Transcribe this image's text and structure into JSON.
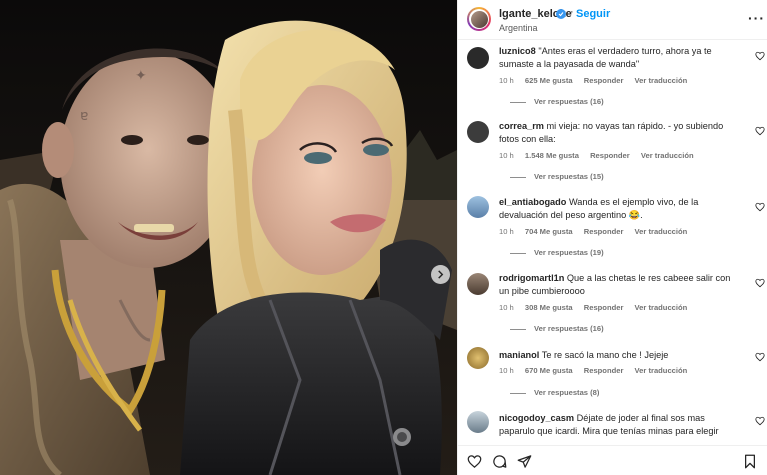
{
  "post": {
    "username": "lgante_keloke",
    "follow_label": "Seguir",
    "location": "Argentina",
    "more_label": "···"
  },
  "comments": [
    {
      "username": "luznico8",
      "text": "\"Antes eras el verdadero turro, ahora ya te sumaste a la payasada de wanda\"",
      "time": "10 h",
      "likes": "625 Me gusta",
      "reply": "Responder",
      "translate": "Ver traducción",
      "replies": "Ver respuestas (16)",
      "avatar_color": "#2a2a2a"
    },
    {
      "username": "correa_rm",
      "text": "mi vieja: no vayas tan rápido. - yo subiendo fotos con ella:",
      "time": "10 h",
      "likes": "1.548 Me gusta",
      "reply": "Responder",
      "translate": "Ver traducción",
      "replies": "Ver respuestas (15)",
      "avatar_color": "#3c3c3c"
    },
    {
      "username": "el_antiabogado",
      "text": "Wanda es el ejemplo vivo, de la devaluación del peso argentino 😂.",
      "time": "10 h",
      "likes": "704 Me gusta",
      "reply": "Responder",
      "translate": "Ver traducción",
      "replies": "Ver respuestas (19)",
      "avatar_color": "#5a7fa8"
    },
    {
      "username": "rodrigomartl1n",
      "text": "Que a las chetas le res cabeee salir con un pibe cumbieroooo",
      "time": "10 h",
      "likes": "308 Me gusta",
      "reply": "Responder",
      "translate": "Ver traducción",
      "replies": "Ver respuestas (16)",
      "avatar_color": "#6b5a4a"
    },
    {
      "username": "manianol",
      "text": "Te re sacó la mano che ! Jejeje",
      "time": "10 h",
      "likes": "670 Me gusta",
      "reply": "Responder",
      "translate": "Ver traducción",
      "replies": "Ver respuestas (8)",
      "avatar_color": "#b89a4a"
    },
    {
      "username": "nicogodoy_casm",
      "text": "Déjate de joder al final sos mas paparulo que icardi. Mira que tenías minas para elegir eeeeeh. Dios mio. Cómo te vas",
      "avatar_color": "#8a9aa8"
    }
  ],
  "icons": {
    "like": "heart-icon",
    "comment": "comment-icon",
    "share": "share-icon",
    "save": "bookmark-icon",
    "next": "chevron-right-icon"
  }
}
